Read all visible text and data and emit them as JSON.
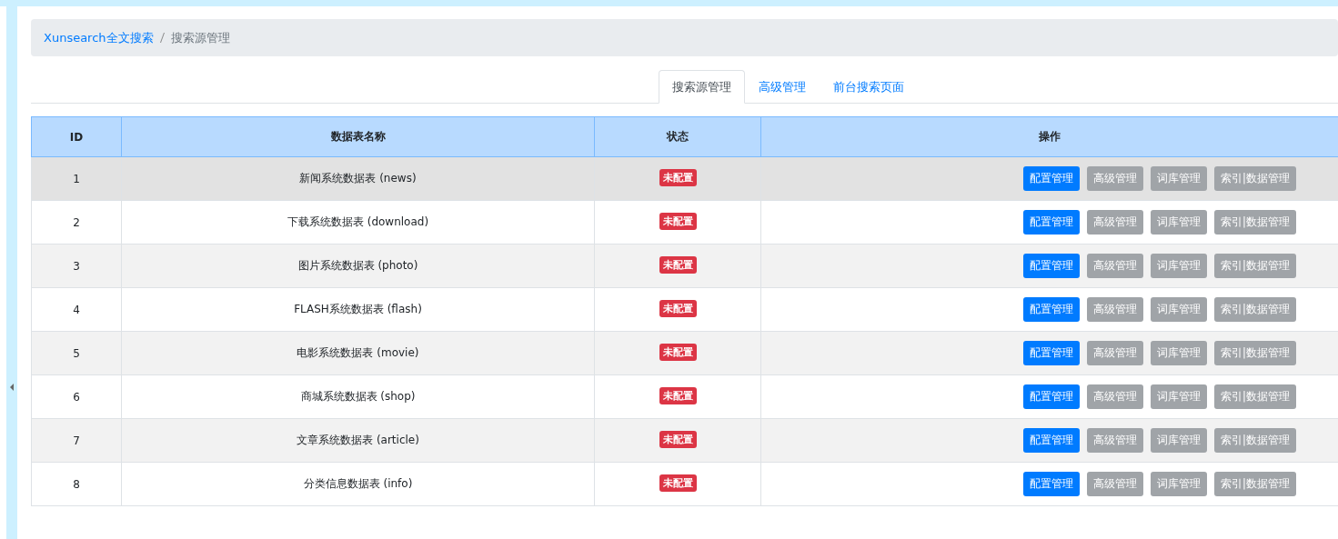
{
  "breadcrumb": [
    {
      "label": "Xunsearch全文搜索",
      "kind": "link"
    },
    {
      "label": "搜索源管理",
      "kind": "current"
    }
  ],
  "tabs": [
    {
      "label": "搜索源管理",
      "selected": true
    },
    {
      "label": "高级管理",
      "selected": false
    },
    {
      "label": "前台搜索页面",
      "selected": false
    }
  ],
  "table": {
    "columns": [
      "ID",
      "数据表名称",
      "状态",
      "操作"
    ],
    "rows": [
      {
        "id": "1",
        "name": "新闻系统数据表 (news)",
        "status": "未配置",
        "highlighted": true,
        "actions": [
          {
            "label": "配置管理",
            "kind": "primary"
          },
          {
            "label": "高级管理",
            "kind": "secondary"
          },
          {
            "label": "词库管理",
            "kind": "secondary"
          },
          {
            "label": "索引|数据管理",
            "kind": "secondary"
          }
        ]
      },
      {
        "id": "2",
        "name": "下载系统数据表 (download)",
        "status": "未配置",
        "highlighted": false,
        "actions": [
          {
            "label": "配置管理",
            "kind": "primary"
          },
          {
            "label": "高级管理",
            "kind": "secondary"
          },
          {
            "label": "词库管理",
            "kind": "secondary"
          },
          {
            "label": "索引|数据管理",
            "kind": "secondary"
          }
        ]
      },
      {
        "id": "3",
        "name": "图片系统数据表 (photo)",
        "status": "未配置",
        "highlighted": false,
        "actions": [
          {
            "label": "配置管理",
            "kind": "primary"
          },
          {
            "label": "高级管理",
            "kind": "secondary"
          },
          {
            "label": "词库管理",
            "kind": "secondary"
          },
          {
            "label": "索引|数据管理",
            "kind": "secondary"
          }
        ]
      },
      {
        "id": "4",
        "name": "FLASH系统数据表 (flash)",
        "status": "未配置",
        "highlighted": false,
        "actions": [
          {
            "label": "配置管理",
            "kind": "primary"
          },
          {
            "label": "高级管理",
            "kind": "secondary"
          },
          {
            "label": "词库管理",
            "kind": "secondary"
          },
          {
            "label": "索引|数据管理",
            "kind": "secondary"
          }
        ]
      },
      {
        "id": "5",
        "name": "电影系统数据表 (movie)",
        "status": "未配置",
        "highlighted": false,
        "actions": [
          {
            "label": "配置管理",
            "kind": "primary"
          },
          {
            "label": "高级管理",
            "kind": "secondary"
          },
          {
            "label": "词库管理",
            "kind": "secondary"
          },
          {
            "label": "索引|数据管理",
            "kind": "secondary"
          }
        ]
      },
      {
        "id": "6",
        "name": "商城系统数据表 (shop)",
        "status": "未配置",
        "highlighted": false,
        "actions": [
          {
            "label": "配置管理",
            "kind": "primary"
          },
          {
            "label": "高级管理",
            "kind": "secondary"
          },
          {
            "label": "词库管理",
            "kind": "secondary"
          },
          {
            "label": "索引|数据管理",
            "kind": "secondary"
          }
        ]
      },
      {
        "id": "7",
        "name": "文章系统数据表 (article)",
        "status": "未配置",
        "highlighted": false,
        "actions": [
          {
            "label": "配置管理",
            "kind": "primary"
          },
          {
            "label": "高级管理",
            "kind": "secondary"
          },
          {
            "label": "词库管理",
            "kind": "secondary"
          },
          {
            "label": "索引|数据管理",
            "kind": "secondary"
          }
        ]
      },
      {
        "id": "8",
        "name": "分类信息数据表 (info)",
        "status": "未配置",
        "highlighted": false,
        "actions": [
          {
            "label": "配置管理",
            "kind": "primary"
          },
          {
            "label": "高级管理",
            "kind": "secondary"
          },
          {
            "label": "词库管理",
            "kind": "secondary"
          },
          {
            "label": "索引|数据管理",
            "kind": "secondary"
          }
        ]
      }
    ]
  }
}
